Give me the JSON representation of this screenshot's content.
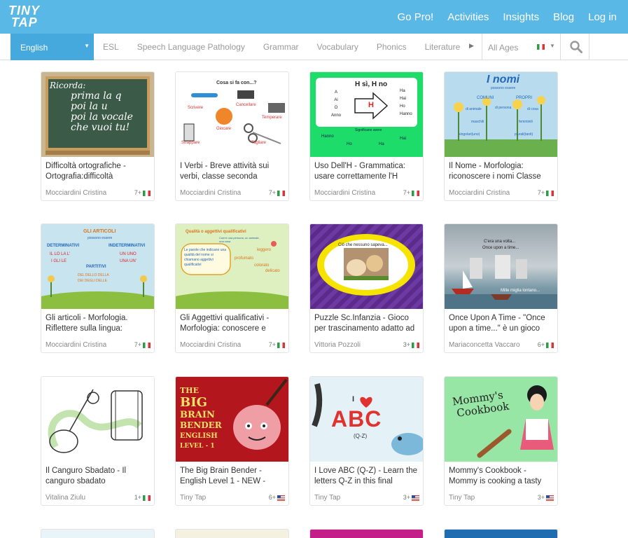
{
  "logo": {
    "line1": "TINY",
    "line2": "TAP"
  },
  "nav": [
    "Go Pro!",
    "Activities",
    "Insights",
    "Blog",
    "Log in"
  ],
  "filters": {
    "language": "English",
    "categories": [
      "ESL",
      "Speech Language Pathology",
      "Grammar",
      "Vocabulary",
      "Phonics",
      "Literature"
    ],
    "age": "All Ages"
  },
  "cards": [
    {
      "title": "Difficoltà ortografiche - Ortografia:difficoltà",
      "author": "Mocciardini Cristina",
      "age": "7+",
      "flag": "it",
      "thumb_text": [
        "Ricorda:",
        "prima la q",
        "poi la u",
        "poi la vocale",
        "che vuoi tu!"
      ]
    },
    {
      "title": "I Verbi - Breve attività sui verbi, classe seconda",
      "author": "Mocciardini Cristina",
      "age": "7+",
      "flag": "it",
      "thumb_text": [
        "Cosa si fa con...?",
        "Scrivere",
        "Cancellare",
        "Temperare",
        "Giocare",
        "Strappare",
        "Tagliare"
      ]
    },
    {
      "title": "Uso Dell'H - Grammatica: usare correttamente l'H",
      "author": "Mocciardini Cristina",
      "age": "7+",
      "flag": "it",
      "thumb_text": [
        "H sì, H no",
        "A",
        "Ai",
        "O",
        "Anno",
        "H",
        "Ha",
        "Hai",
        "Ho",
        "Hanno",
        "Significano avere",
        "Hanno",
        "Ho",
        "Ha",
        "Hai"
      ]
    },
    {
      "title": "Il Nome - Morfologia: riconoscere i nomi Classe",
      "author": "Mocciardini Cristina",
      "age": "7+",
      "flag": "it",
      "thumb_text": [
        "I nomi",
        "possono essere",
        "COMUNI",
        "PROPRI",
        "di animale",
        "di persona",
        "di cosa",
        "maschili",
        "femminili",
        "singolari(uno)",
        "plurali(tanti)"
      ]
    },
    {
      "title": "Gli articoli - Morfologia. Riflettere sulla lingua:",
      "author": "Mocciardini Cristina",
      "age": "7+",
      "flag": "it",
      "thumb_text": [
        "GLI ARTICOLI",
        "possono essere",
        "DETERMINATIVI",
        "INDETERMINATIVI",
        "IL LO LA L'",
        "I GLI LE",
        "UN UNO",
        "UNA UN'",
        "PARTITIVI",
        "DEL DELLO DELLA",
        "DEI DEGLI DELLE"
      ]
    },
    {
      "title": "Gli Aggettivi qualificativi - Morfologia: conoscere e",
      "author": "Mocciardini Cristina",
      "age": "7+",
      "flag": "it",
      "thumb_text": [
        "Qualità o aggettivi qualificativi",
        "Com'è una persona, un animale, una cosa",
        "Le parole che indicano una qualità del nome si chiamano aggettivi qualificativi",
        "leggero",
        "profumato",
        "colorato",
        "delicato"
      ]
    },
    {
      "title": "Puzzle Sc.Infanzia - Gioco per trascinamento adatto ad",
      "author": "Vittoria Pozzoli",
      "age": "3+",
      "flag": "it",
      "thumb_text": [
        "Ciò che nessuno sapeva..."
      ]
    },
    {
      "title": "Once Upon A Time - \"Once upon a time...\" è un gioco",
      "author": "Mariaconcetta Vaccaro",
      "age": "6+",
      "flag": "it",
      "thumb_text": [
        "C'era una volta...",
        "Once upon a time...",
        "Mille miglia lontano..."
      ]
    },
    {
      "title": "Il Canguro Sbadato - Il canguro sbadato",
      "author": "Vitalina Ziulu",
      "age": "1+",
      "flag": "it",
      "thumb_text": []
    },
    {
      "title": "The Big Brain Bender - English Level 1 - NEW -",
      "author": "Tiny Tap",
      "age": "6+",
      "flag": "us",
      "thumb_text": [
        "THE",
        "BIG",
        "BRAIN",
        "BENDER",
        "ENGLISH",
        "LEVEL - 1"
      ]
    },
    {
      "title": "I Love ABC (Q-Z) - Learn the letters Q-Z in this final",
      "author": "Tiny Tap",
      "age": "3+",
      "flag": "us",
      "thumb_text": [
        "I",
        "ABC",
        "(Q-Z)"
      ]
    },
    {
      "title": "Mommy's Cookbook - Mommy is cooking a tasty",
      "author": "Tiny Tap",
      "age": "3+",
      "flag": "us",
      "thumb_text": [
        "Mommy's",
        "Cookbook"
      ]
    }
  ],
  "colors": {
    "topbar": "#5ab8e6",
    "language_select": "#45a9de"
  },
  "icons": {
    "search": "search-icon",
    "caret": "caret-down-icon",
    "arrow": "arrow-right-icon"
  }
}
